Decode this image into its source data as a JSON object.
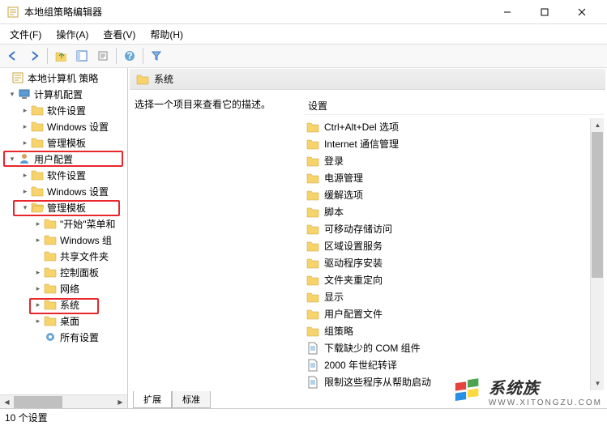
{
  "window": {
    "title": "本地组策略编辑器"
  },
  "menu": {
    "file": "文件(F)",
    "action": "操作(A)",
    "view": "查看(V)",
    "help": "帮助(H)"
  },
  "tree": {
    "root": "本地计算机 策略",
    "computer_config": "计算机配置",
    "cc_software": "软件设置",
    "cc_windows": "Windows 设置",
    "cc_admin": "管理模板",
    "user_config": "用户配置",
    "uc_software": "软件设置",
    "uc_windows": "Windows 设置",
    "uc_admin": "管理模板",
    "uc_start": "\"开始\"菜单和",
    "uc_wincomp": "Windows 组",
    "uc_share": "共享文件夹",
    "uc_cpanel": "控制面板",
    "uc_network": "网络",
    "uc_system": "系统",
    "uc_desktop": "桌面",
    "uc_allsettings": "所有设置"
  },
  "right": {
    "header": "系统",
    "desc_prompt": "选择一个项目来查看它的描述。",
    "col_setting": "设置",
    "items": [
      "Ctrl+Alt+Del 选项",
      "Internet 通信管理",
      "登录",
      "电源管理",
      "缓解选项",
      "脚本",
      "可移动存储访问",
      "区域设置服务",
      "驱动程序安装",
      "文件夹重定向",
      "显示",
      "用户配置文件",
      "组策略"
    ],
    "file_items": [
      "下载缺少的 COM 组件",
      "2000 年世纪转译",
      "限制这些程序从帮助启动"
    ]
  },
  "tabs": {
    "extended": "扩展",
    "standard": "标准"
  },
  "status": {
    "text": "10 个设置"
  },
  "watermark": {
    "text": "系统族",
    "url": "WWW.XITONGZU.COM"
  }
}
